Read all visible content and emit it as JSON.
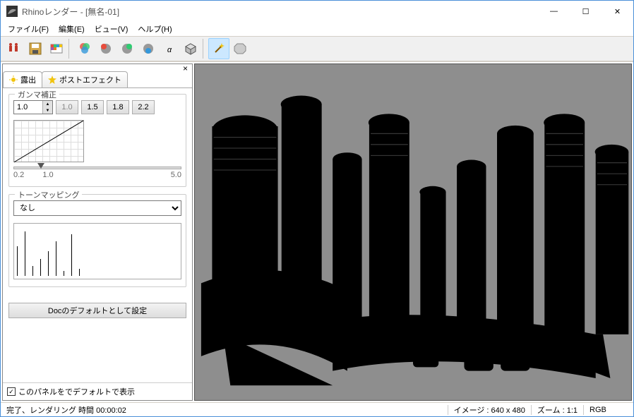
{
  "window": {
    "title": "Rhinoレンダー - [無名-01]"
  },
  "menu": {
    "file": "ファイル(F)",
    "edit": "編集(E)",
    "view": "ビュー(V)",
    "help": "ヘルプ(H)"
  },
  "tabs": {
    "exposure": "露出",
    "posteffect": "ポストエフェクト"
  },
  "gamma": {
    "legend": "ガンマ補正",
    "value": "1.0",
    "presets": [
      "1.0",
      "1.5",
      "1.8",
      "2.2"
    ],
    "slider": {
      "min": "0.2",
      "mid": "1.0",
      "max": "5.0"
    }
  },
  "tonemap": {
    "legend": "トーンマッピング",
    "value": "なし"
  },
  "buttons": {
    "save_default": "Docのデフォルトとして設定"
  },
  "panel_footer": {
    "checkbox_label": "このパネルをでデフォルトで表示",
    "checked": "✓"
  },
  "status": {
    "left": "完了、レンダリング 時間  00:00:02",
    "image": "イメージ : 640 x 480",
    "zoom": "ズーム : 1:1",
    "mode": "RGB"
  },
  "icons": {
    "app": "rhino",
    "minimize": "—",
    "maximize": "☐",
    "close": "✕",
    "panel_close": "×"
  }
}
